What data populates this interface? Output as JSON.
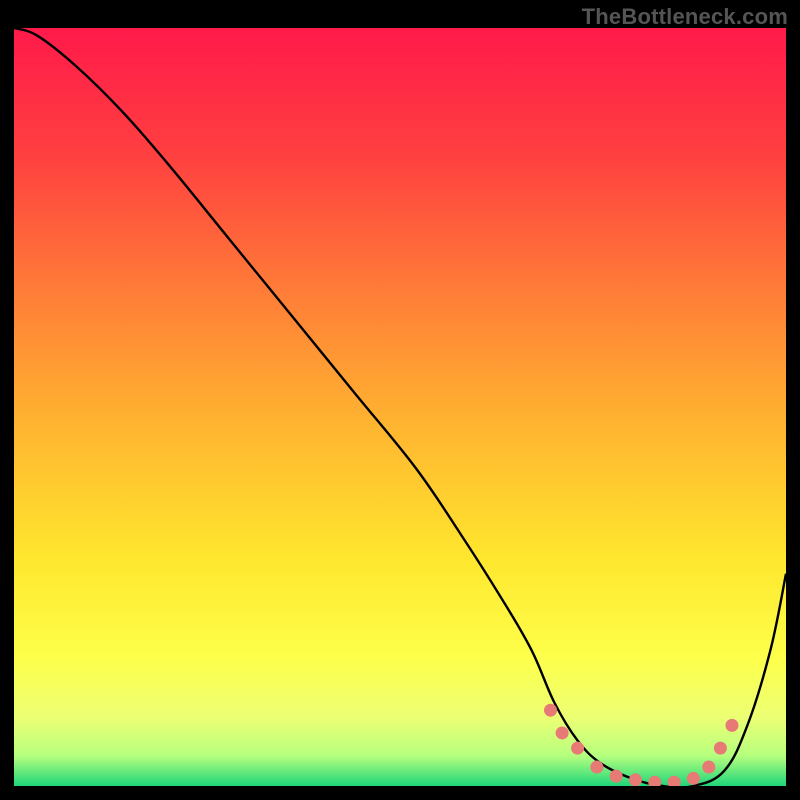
{
  "watermark": "TheBottleneck.com",
  "chart_data": {
    "type": "line",
    "title": "",
    "xlabel": "",
    "ylabel": "",
    "xlim": [
      0,
      100
    ],
    "ylim": [
      0,
      100
    ],
    "grid": false,
    "legend": false,
    "background": {
      "type": "vertical-gradient",
      "stops": [
        {
          "pos": 0,
          "color": "#ff1a4a"
        },
        {
          "pos": 17,
          "color": "#ff4040"
        },
        {
          "pos": 34,
          "color": "#ff7a38"
        },
        {
          "pos": 52,
          "color": "#ffb330"
        },
        {
          "pos": 70,
          "color": "#ffe72e"
        },
        {
          "pos": 83,
          "color": "#fdff4a"
        },
        {
          "pos": 91,
          "color": "#ecff74"
        },
        {
          "pos": 96,
          "color": "#b6ff7e"
        },
        {
          "pos": 100,
          "color": "#1fd67a"
        }
      ]
    },
    "series": [
      {
        "name": "bottleneck-curve",
        "stroke": "#000000",
        "x": [
          0,
          3,
          8,
          14,
          20,
          28,
          36,
          44,
          52,
          58,
          63,
          67,
          70,
          73,
          76,
          80,
          84,
          88,
          92,
          95,
          98,
          100
        ],
        "y": [
          100,
          99,
          95,
          89,
          82,
          72,
          62,
          52,
          42,
          33,
          25,
          18,
          11,
          6,
          3,
          1,
          0,
          0,
          2,
          8,
          18,
          28
        ]
      }
    ],
    "markers": {
      "name": "bottom-dots",
      "color": "#e77a74",
      "points": [
        {
          "x": 69.5,
          "y": 10
        },
        {
          "x": 71.0,
          "y": 7
        },
        {
          "x": 73.0,
          "y": 5
        },
        {
          "x": 75.5,
          "y": 2.5
        },
        {
          "x": 78.0,
          "y": 1.3
        },
        {
          "x": 80.5,
          "y": 0.8
        },
        {
          "x": 83.0,
          "y": 0.5
        },
        {
          "x": 85.5,
          "y": 0.5
        },
        {
          "x": 88.0,
          "y": 1.0
        },
        {
          "x": 90.0,
          "y": 2.5
        },
        {
          "x": 91.5,
          "y": 5.0
        },
        {
          "x": 93.0,
          "y": 8.0
        }
      ]
    }
  }
}
